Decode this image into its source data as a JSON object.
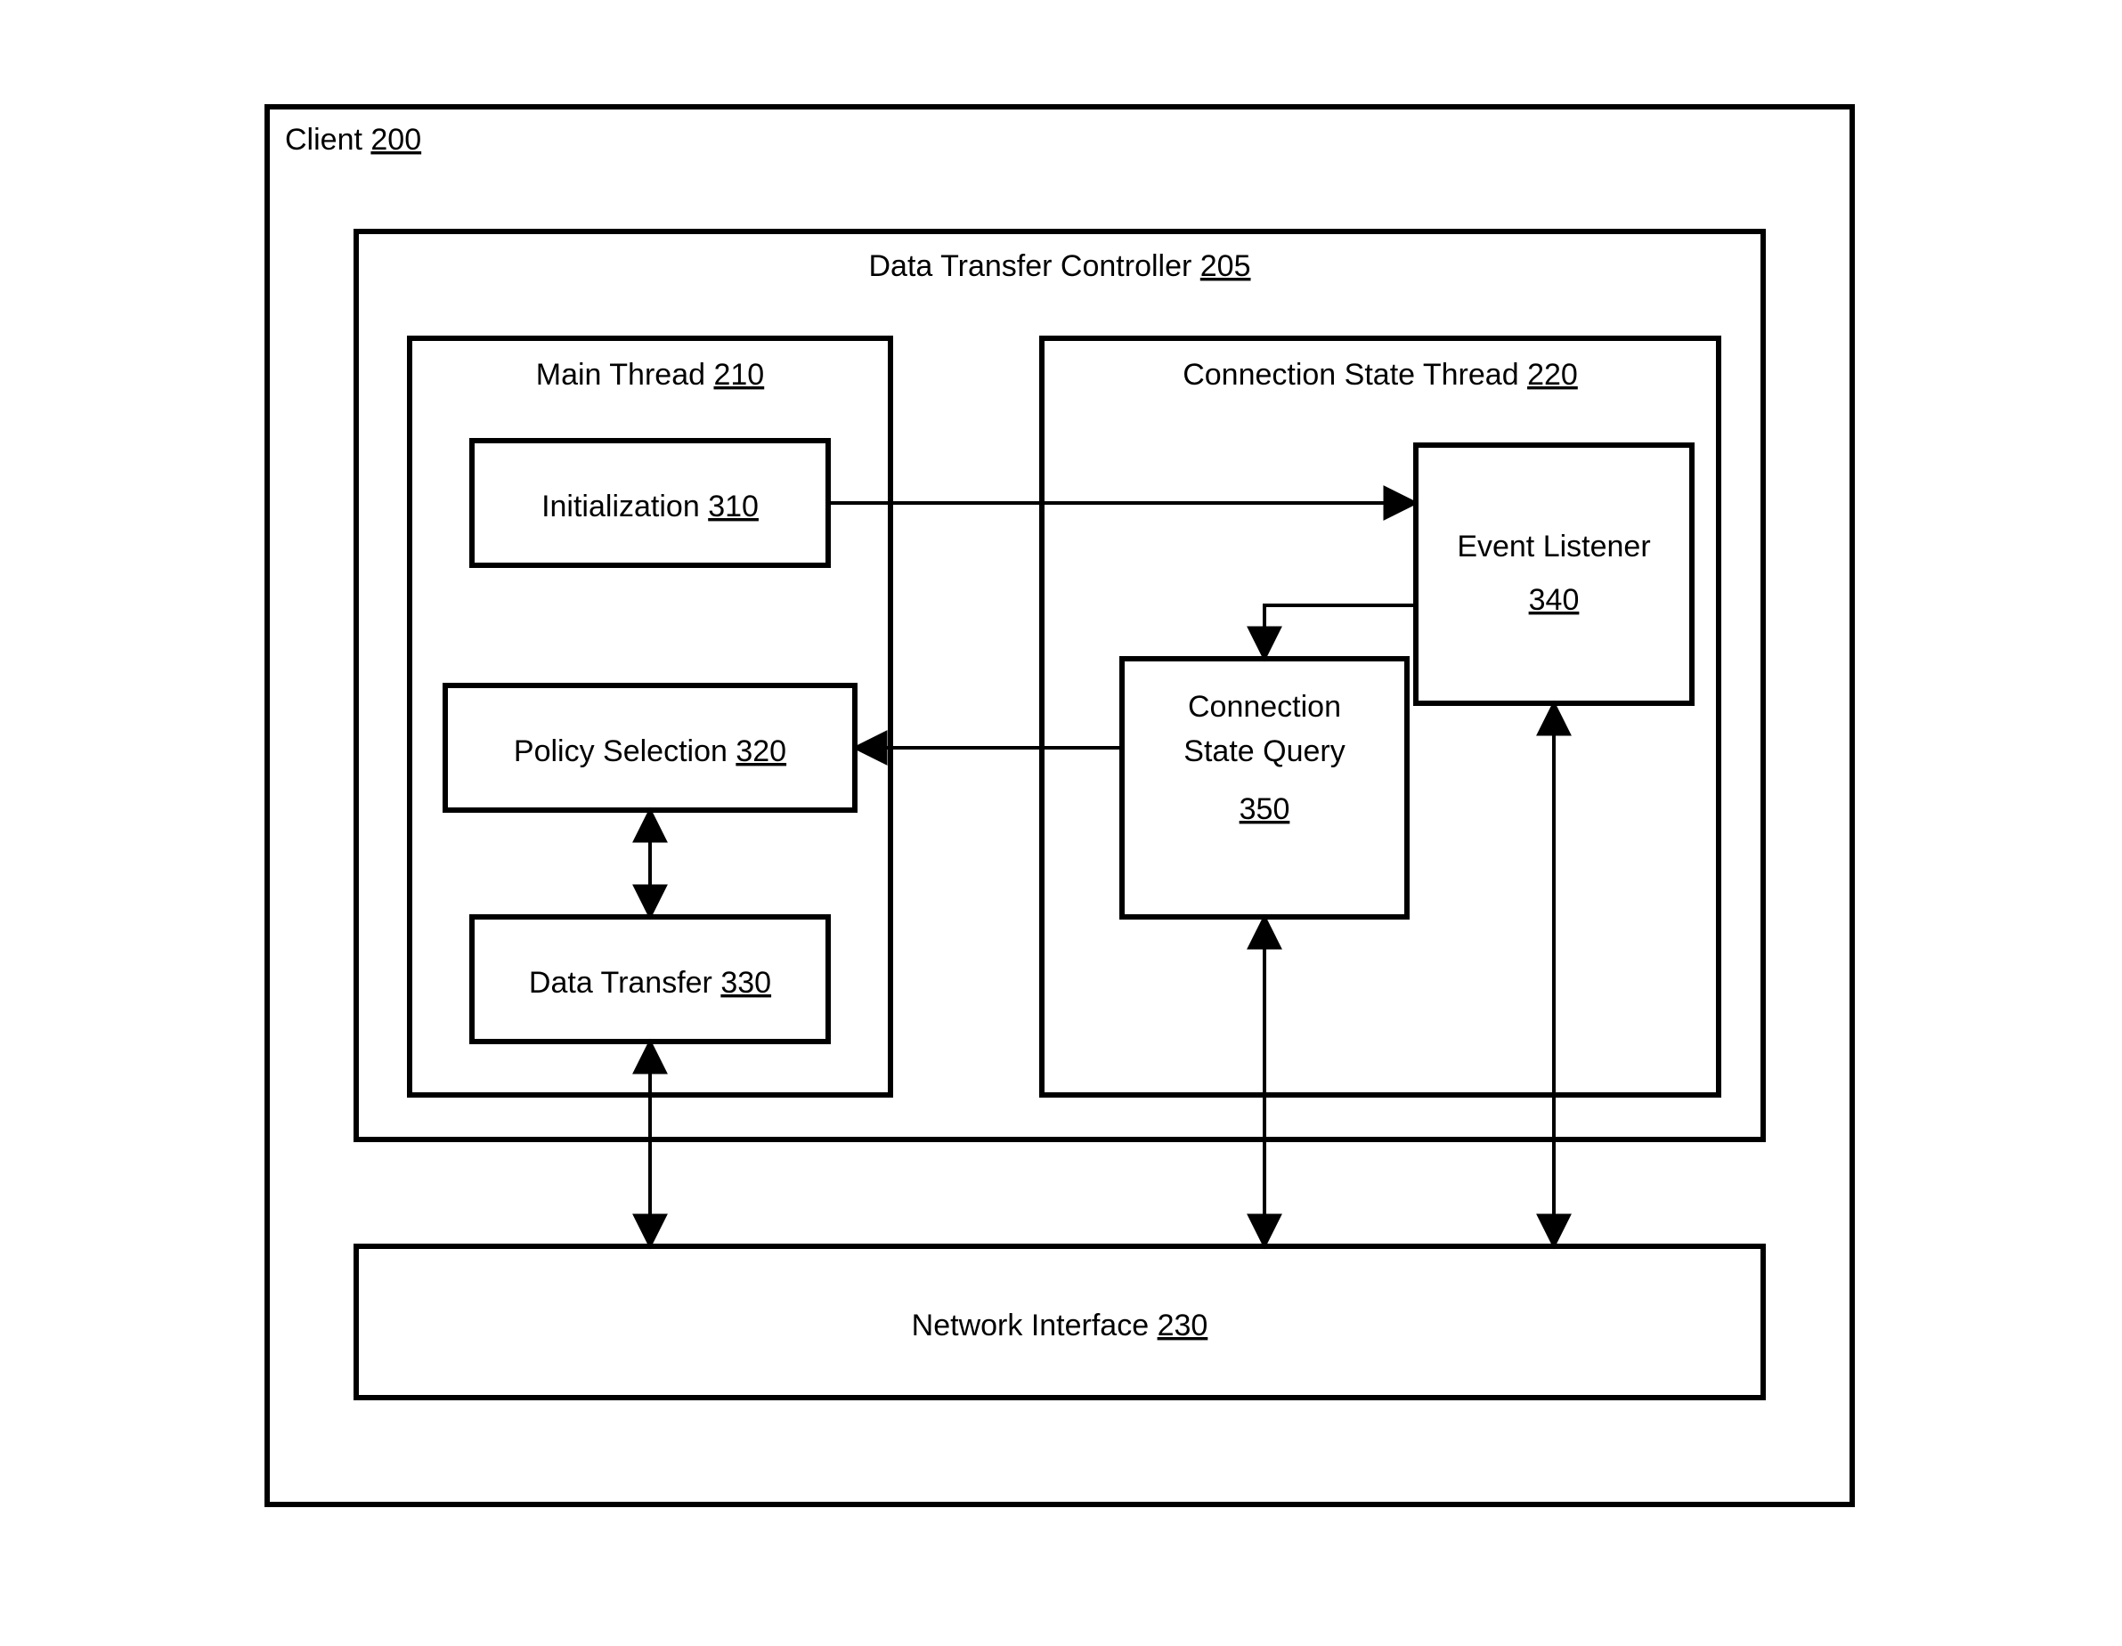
{
  "client": {
    "label": "Client",
    "num": "200"
  },
  "dtc": {
    "label": "Data Transfer Controller",
    "num": "205"
  },
  "main": {
    "label": "Main Thread",
    "num": "210"
  },
  "conn": {
    "label": "Connection State Thread",
    "num": "220"
  },
  "init": {
    "label": "Initialization",
    "num": "310"
  },
  "policy": {
    "label": "Policy Selection",
    "num": "320"
  },
  "xfer": {
    "label": "Data Transfer",
    "num": "330"
  },
  "netif": {
    "label": "Network Interface",
    "num": "230"
  },
  "evlis": {
    "label": "Event Listener",
    "num": "340"
  },
  "csq": {
    "label1": "Connection",
    "label2": "State Query",
    "num": "350"
  }
}
